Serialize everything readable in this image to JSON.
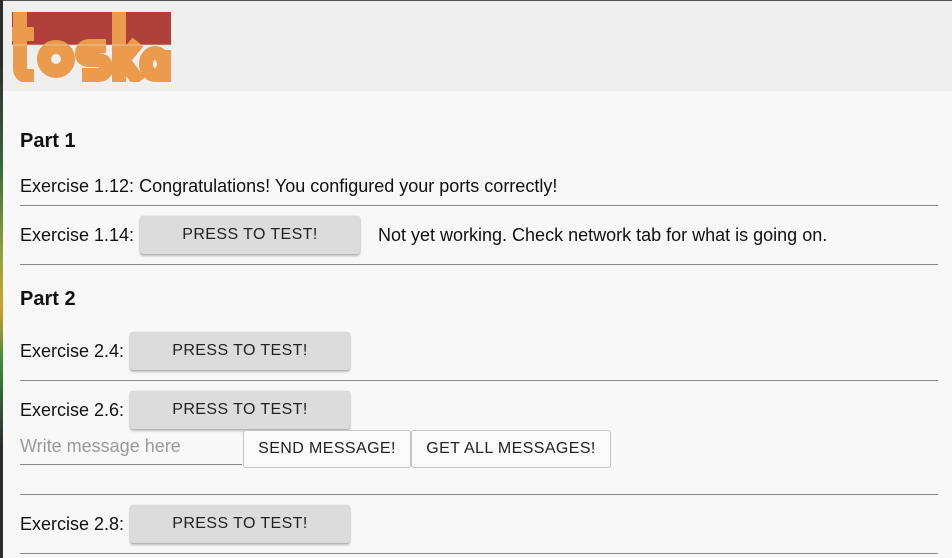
{
  "header": {
    "logo_text": "toska",
    "colors": {
      "logo_bar": "#b0403a",
      "logo_letters": "#ec9a4c"
    }
  },
  "part1": {
    "title": "Part 1",
    "ex1_12": {
      "label": "Exercise 1.12:",
      "status": "Congratulations! You configured your ports correctly!"
    },
    "ex1_14": {
      "label": "Exercise 1.14:",
      "button": "PRESS TO TEST!",
      "status": "Not yet working. Check network tab for what is going on."
    }
  },
  "part2": {
    "title": "Part 2",
    "ex2_4": {
      "label": "Exercise 2.4:",
      "button": "PRESS TO TEST!"
    },
    "ex2_6": {
      "label": "Exercise 2.6:",
      "button": "PRESS TO TEST!",
      "input_placeholder": "Write message here",
      "input_value": "",
      "send_button": "SEND MESSAGE!",
      "get_button": "GET ALL MESSAGES!"
    },
    "ex2_8": {
      "label": "Exercise 2.8:",
      "button": "PRESS TO TEST!"
    }
  }
}
